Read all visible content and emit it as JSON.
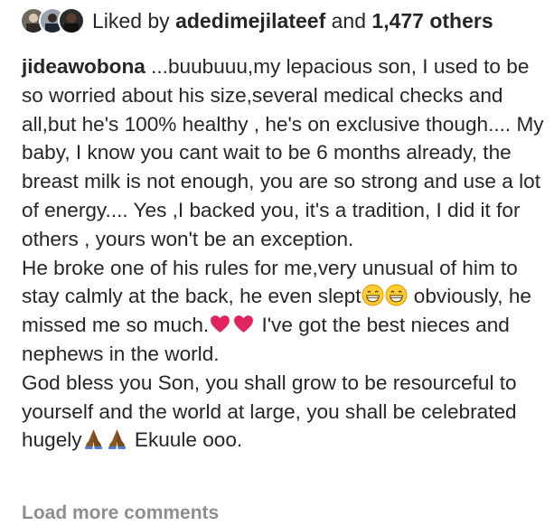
{
  "likes": {
    "prefix": "Liked by",
    "user": "adedimejilateef",
    "connector": "and",
    "count": "1,477 others"
  },
  "caption": {
    "username": "jideawobona",
    "paragraph1": " ...buubuuu,my lepacious son, I used to be so worried about his size,several medical checks and all,but he's 100% healthy , he's on exclusive though.... My baby, I know you cant wait to be 6 months already, the breast milk is not enough, you are so strong and use a lot of energy.... Yes ,I backed you, it's a tradition, I did it for others , yours won't be an exception.",
    "paragraph2_a": "He broke one of his rules for me,very unusual of him to stay calmly at the back, he even slept",
    "paragraph2_b": " obviously, he missed me so much.",
    "paragraph2_c": " I've got the best nieces and nephews in the world.",
    "paragraph3_a": "God bless you Son, you shall grow to be resourceful to yourself and the world at large, you shall be celebrated hugely",
    "paragraph3_b": " Ekuule ooo."
  },
  "icons": {
    "avatar1": "profile-avatar-icon",
    "avatar2": "profile-avatar-icon",
    "avatar3": "profile-avatar-icon",
    "grin": "grinning-face-icon",
    "heart": "red-heart-icon",
    "pray": "folded-hands-icon"
  },
  "colors": {
    "text": "#262626",
    "muted": "#8e8e8e",
    "heart": "#e0245e"
  },
  "load_more": "Load more comments"
}
